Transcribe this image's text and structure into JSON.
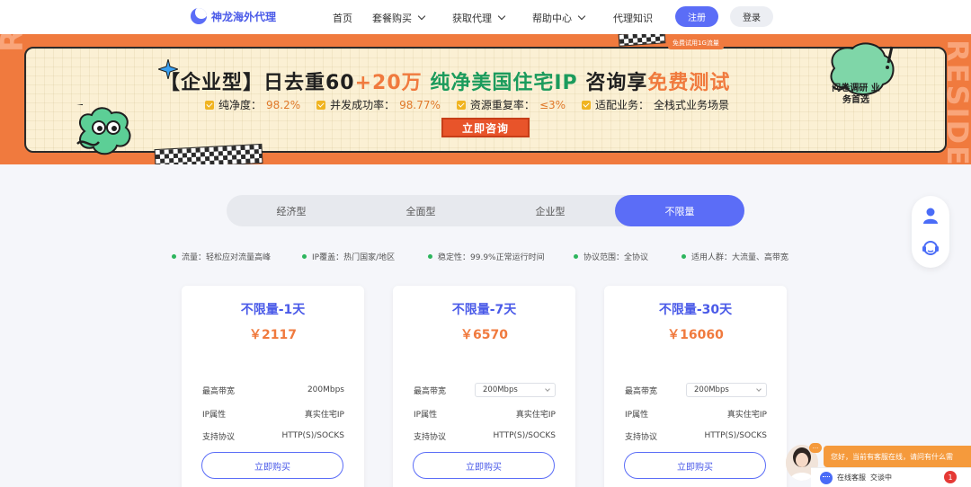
{
  "nav": {
    "logo_text": "神龙海外代理",
    "items": [
      {
        "label": "首页",
        "has_dropdown": false
      },
      {
        "label": "套餐购买",
        "has_dropdown": true
      },
      {
        "label": "获取代理",
        "has_dropdown": true
      },
      {
        "label": "帮助中心",
        "has_dropdown": true
      },
      {
        "label": "代理知识",
        "has_dropdown": false
      }
    ],
    "register_label": "注册",
    "login_label": "登录"
  },
  "banner": {
    "side_text": "RESIDENTIAL",
    "trial_tag": "免费试用1G流量",
    "headline_prefix": "【企业型】日去重60",
    "headline_plus": "+20万",
    "headline_mid": " 纯净美国住宅IP",
    "headline_suffix_1": " 咨询享",
    "headline_accent": "免费测试",
    "features": [
      {
        "label": "纯净度：",
        "value": "98.2%"
      },
      {
        "label": "并发成功率：",
        "value": "98.77%"
      },
      {
        "label": "资源重复率：",
        "value": "≤3%"
      },
      {
        "label": "适配业务：",
        "value": "全栈式业务场景"
      }
    ],
    "cta_label": "立即咨询",
    "badge_text": "问卷调研 业务首选"
  },
  "plan_tabs": [
    {
      "label": "经济型",
      "active": false
    },
    {
      "label": "全面型",
      "active": false
    },
    {
      "label": "企业型",
      "active": false
    },
    {
      "label": "不限量",
      "active": true
    }
  ],
  "plan_features": [
    "流量：轻松应对流量高峰",
    "IP覆盖：热门国家/地区",
    "稳定性：99.9%正常运行时间",
    "协议范围：全协议",
    "适用人群：大流量、高带宽"
  ],
  "cards": [
    {
      "title": "不限量-1天",
      "price": "￥2117",
      "bandwidth_label": "最高带宽",
      "bandwidth_value": "200Mbps",
      "bandwidth_is_select": false,
      "ip_label": "IP属性",
      "ip_value": "真实住宅IP",
      "protocol_label": "支持协议",
      "protocol_value": "HTTP(S)/SOCKS",
      "buy_label": "立即购买"
    },
    {
      "title": "不限量-7天",
      "price": "￥6570",
      "bandwidth_label": "最高带宽",
      "bandwidth_value": "200Mbps",
      "bandwidth_is_select": true,
      "ip_label": "IP属性",
      "ip_value": "真实住宅IP",
      "protocol_label": "支持协议",
      "protocol_value": "HTTP(S)/SOCKS",
      "buy_label": "立即购买"
    },
    {
      "title": "不限量-30天",
      "price": "￥16060",
      "bandwidth_label": "最高带宽",
      "bandwidth_value": "200Mbps",
      "bandwidth_is_select": true,
      "ip_label": "IP属性",
      "ip_value": "真实住宅IP",
      "protocol_label": "支持协议",
      "protocol_value": "HTTP(S)/SOCKS",
      "buy_label": "立即购买"
    }
  ],
  "float_icons": [
    "user-icon",
    "customer-service-icon"
  ],
  "chat": {
    "bubble_text": "您好，当前有客服在线，请问有什么需",
    "bubble_dots": "···",
    "bar_label": "在线客服",
    "bar_action": "交谈中",
    "unread_count": "1"
  },
  "colors": {
    "primary": "#5b6df7",
    "accent_orange": "#f07a3e",
    "banner_bg": "#f07a3e",
    "success_dot": "#2db55d"
  }
}
